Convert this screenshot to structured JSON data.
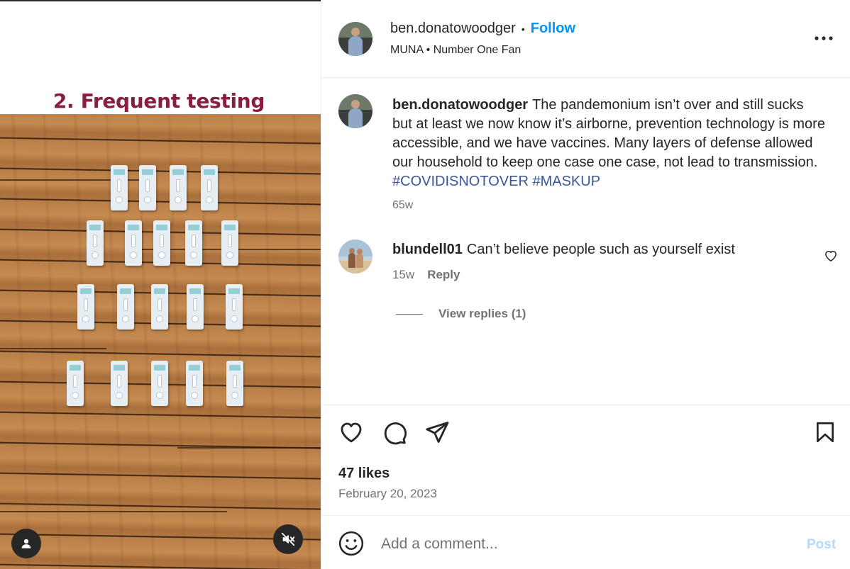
{
  "media": {
    "slide_title": "2. Frequent testing",
    "image_subject": "rapid antigen test cassettes arranged in rows on a hardwood floor"
  },
  "header": {
    "username": "ben.donatowoodger",
    "separator": "•",
    "follow_label": "Follow",
    "subtitle": "MUNA • Number One Fan"
  },
  "caption": {
    "username": "ben.donatowoodger",
    "text": "The pandemonium isn’t over and still sucks but at least we now know it’s airborne, prevention technology is more accessible, and we have vaccines. Many layers of defense allowed our household to keep one case one case, not lead to transmission.",
    "hashtags": [
      "#COVIDISNOTOVER",
      "#MASKUP"
    ],
    "time": "65w"
  },
  "comments": [
    {
      "username": "blundell01",
      "text": "Can’t believe people such as yourself exist",
      "time": "15w",
      "reply_label": "Reply",
      "view_replies_label": "View replies (1)"
    }
  ],
  "stats": {
    "likes": "47 likes",
    "date": "February 20, 2023"
  },
  "composer": {
    "placeholder": "Add a comment...",
    "post_label": "Post"
  },
  "icons": {
    "more": "more-options-icon",
    "comment_like": "heart-icon",
    "like": "heart-icon",
    "comment": "speech-bubble-icon",
    "share": "paper-plane-icon",
    "save": "bookmark-icon",
    "emoji": "smiley-icon",
    "user_tag": "person-icon",
    "mute": "speaker-muted-icon"
  },
  "colors": {
    "accent": "#0095f6",
    "hashtag": "#385898",
    "slide_title": "#8a1f3d",
    "secondary_text": "#737373",
    "post_disabled": "#b3dbff"
  }
}
